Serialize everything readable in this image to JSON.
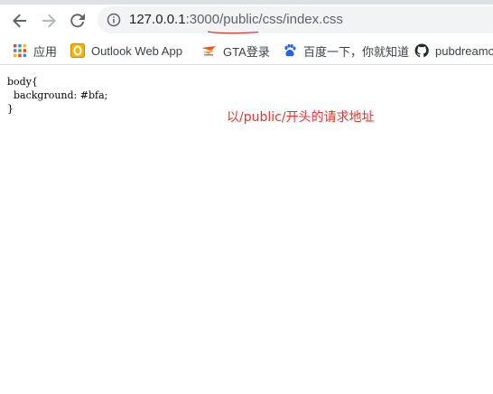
{
  "toolbar": {
    "back_icon": "arrow-left-icon",
    "forward_icon": "arrow-right-icon",
    "reload_icon": "reload-icon"
  },
  "omnibox": {
    "info_icon": "info-icon",
    "url_host": "127.0.0.1",
    "url_path": ":3000/public/css/index.css"
  },
  "bookmarks": [
    {
      "label": "应用",
      "icon": "apps-grid-icon"
    },
    {
      "label": "Outlook Web App",
      "icon": "outlook-icon"
    },
    {
      "label": "GTA登录",
      "icon": "gta-logo-icon"
    },
    {
      "label": "百度一下，你就知道",
      "icon": "baidu-paw-icon"
    },
    {
      "label": "pubdreamc",
      "icon": "github-icon"
    }
  ],
  "page": {
    "code": "body{\n  background: #bfa;\n}",
    "annotation": "以/public/开头的请求地址"
  },
  "colors": {
    "annotation": "#e8312f",
    "omnibox_bg": "#f1f3f4"
  }
}
